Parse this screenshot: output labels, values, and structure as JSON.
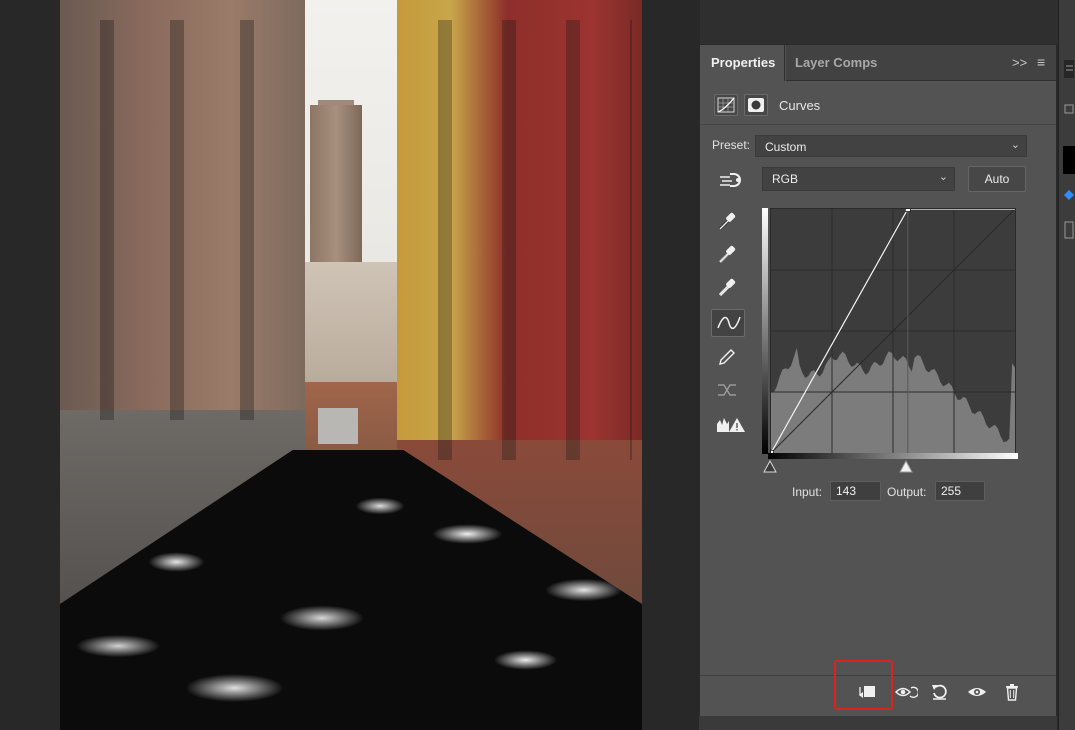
{
  "document": {
    "image_description_icon": "photo-canvas"
  },
  "panel": {
    "tabs": [
      {
        "label": "Properties",
        "active": true
      },
      {
        "label": "Layer Comps",
        "active": false
      }
    ],
    "collapse_glyph": ">>",
    "menu_glyph": "≡",
    "adjustment_title": "Curves",
    "preset_label": "Preset:",
    "preset_value": "Custom",
    "channel_value": "RGB",
    "auto_label": "Auto",
    "input_label": "Input:",
    "input_value": "143",
    "output_label": "Output:",
    "output_value": "255"
  },
  "curve": {
    "channel": "RGB",
    "points": [
      [
        0,
        0
      ],
      [
        143,
        255
      ]
    ],
    "histogram_shape": "dense midtones, low highlights"
  },
  "tools": [
    "targeted-adjustment-icon",
    "black-eyedropper-icon",
    "gray-eyedropper-icon",
    "white-eyedropper-icon",
    "curve-edit-points-icon",
    "pencil-draw-icon",
    "smooth-curve-icon",
    "clipping-warning-icon"
  ],
  "bottom_bar": [
    "clip-to-layer-icon",
    "view-previous-state-icon",
    "reset-defaults-icon",
    "toggle-visibility-icon",
    "delete-adjustment-icon"
  ],
  "colors": {
    "panel_bg": "#535353",
    "highlight_red": "#e0211a",
    "accent_blue": "#2f8cff"
  }
}
